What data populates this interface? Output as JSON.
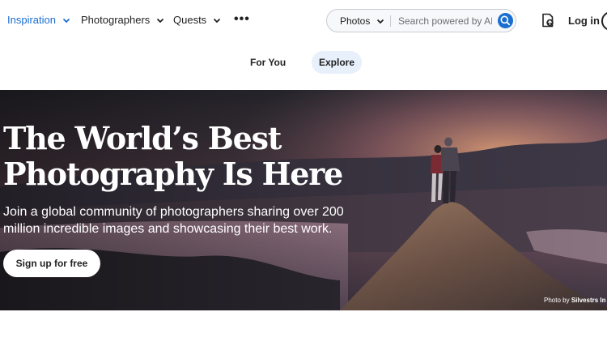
{
  "nav": {
    "items": [
      {
        "label": "Inspiration",
        "active": true
      },
      {
        "label": "Photographers",
        "active": false
      },
      {
        "label": "Quests",
        "active": false
      }
    ],
    "more_label": "•••",
    "search": {
      "type_label": "Photos",
      "placeholder": "Search powered by AI"
    },
    "login_label": "Log in",
    "accent_color": "#1a6ed1"
  },
  "tabs": [
    {
      "label": "For You",
      "selected": false
    },
    {
      "label": "Explore",
      "selected": true
    }
  ],
  "hero": {
    "title_line1": "The World’s Best",
    "title_line2": "Photography Is Here",
    "subtitle": "Join a global community of photographers sharing over 200 million incredible images and showcasing their best work.",
    "cta_label": "Sign up for free",
    "credit_prefix": "Photo by",
    "credit_name": "Silvestrs In"
  }
}
